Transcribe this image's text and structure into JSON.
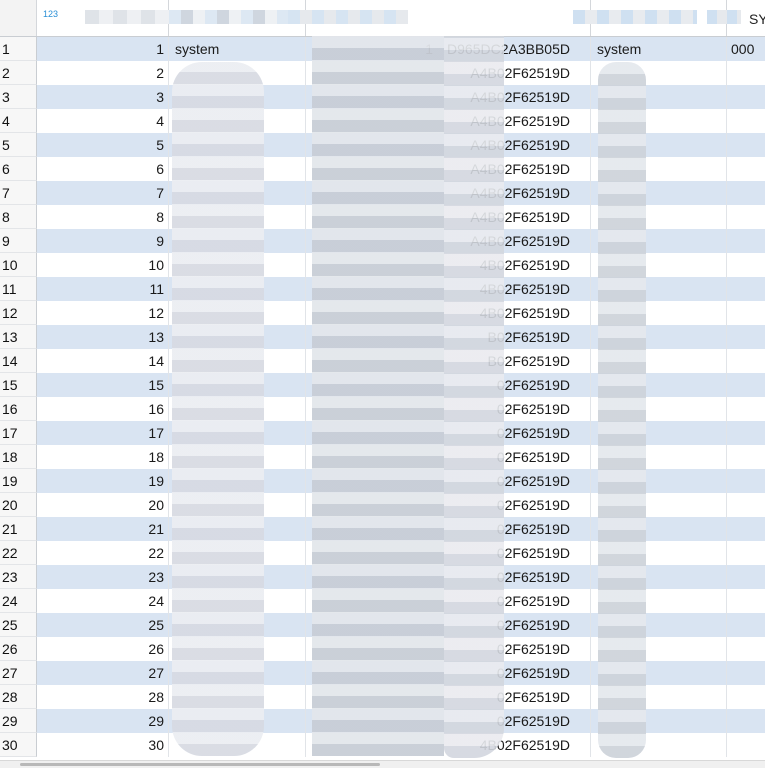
{
  "header": {
    "type_badge": "123",
    "col1_label": "",
    "col2_label": "",
    "col3_label": "",
    "col4_label": "",
    "col5_label": "SY"
  },
  "rows": [
    {
      "row": "1",
      "num": "1",
      "name": "system",
      "id": "1 D965DC2A3BB05D",
      "display": "system",
      "last": "000"
    },
    {
      "row": "2",
      "num": "2",
      "name": "",
      "id": "A4B02F62519D",
      "display": "",
      "last": ""
    },
    {
      "row": "3",
      "num": "3",
      "name": "",
      "id": "A4B02F62519D",
      "display": "",
      "last": ""
    },
    {
      "row": "4",
      "num": "4",
      "name": "",
      "id": "A4B02F62519D",
      "display": "",
      "last": ""
    },
    {
      "row": "5",
      "num": "5",
      "name": "",
      "id": "A4B02F62519D",
      "display": "",
      "last": ""
    },
    {
      "row": "6",
      "num": "6",
      "name": "",
      "id": "A4B02F62519D",
      "display": "",
      "last": ""
    },
    {
      "row": "7",
      "num": "7",
      "name": "",
      "id": "A4B02F62519D",
      "display": "",
      "last": ""
    },
    {
      "row": "8",
      "num": "8",
      "name": "",
      "id": "A4B02F62519D",
      "display": "",
      "last": ""
    },
    {
      "row": "9",
      "num": "9",
      "name": "",
      "id": "A4B02F62519D",
      "display": "",
      "last": ""
    },
    {
      "row": "10",
      "num": "10",
      "name": "",
      "id": "4B02F62519D",
      "display": "",
      "last": ""
    },
    {
      "row": "11",
      "num": "11",
      "name": "",
      "id": "4B02F62519D",
      "display": "",
      "last": ""
    },
    {
      "row": "12",
      "num": "12",
      "name": "",
      "id": "4B02F62519D",
      "display": "",
      "last": ""
    },
    {
      "row": "13",
      "num": "13",
      "name": "",
      "id": "B02F62519D",
      "display": "",
      "last": ""
    },
    {
      "row": "14",
      "num": "14",
      "name": "",
      "id": "B02F62519D",
      "display": "",
      "last": ""
    },
    {
      "row": "15",
      "num": "15",
      "name": "",
      "id": "02F62519D",
      "display": "",
      "last": ""
    },
    {
      "row": "16",
      "num": "16",
      "name": "",
      "id": "02F62519D",
      "display": "",
      "last": ""
    },
    {
      "row": "17",
      "num": "17",
      "name": "",
      "id": "02F62519D",
      "display": "",
      "last": ""
    },
    {
      "row": "18",
      "num": "18",
      "name": "",
      "id": "02F62519D",
      "display": "",
      "last": ""
    },
    {
      "row": "19",
      "num": "19",
      "name": "",
      "id": "02F62519D",
      "display": "",
      "last": ""
    },
    {
      "row": "20",
      "num": "20",
      "name": "",
      "id": "02F62519D",
      "display": "",
      "last": ""
    },
    {
      "row": "21",
      "num": "21",
      "name": "",
      "id": "02F62519D",
      "display": "",
      "last": ""
    },
    {
      "row": "22",
      "num": "22",
      "name": "",
      "id": "02F62519D",
      "display": "",
      "last": ""
    },
    {
      "row": "23",
      "num": "23",
      "name": "",
      "id": "02F62519D",
      "display": "",
      "last": ""
    },
    {
      "row": "24",
      "num": "24",
      "name": "",
      "id": "02F62519D",
      "display": "",
      "last": ""
    },
    {
      "row": "25",
      "num": "25",
      "name": "",
      "id": "02F62519D",
      "display": "",
      "last": ""
    },
    {
      "row": "26",
      "num": "26",
      "name": "",
      "id": "02F62519D",
      "display": "",
      "last": ""
    },
    {
      "row": "27",
      "num": "27",
      "name": "",
      "id": "02F62519D",
      "display": "",
      "last": ""
    },
    {
      "row": "28",
      "num": "28",
      "name": "",
      "id": "02F62519D",
      "display": "",
      "last": ""
    },
    {
      "row": "29",
      "num": "29",
      "name": "",
      "id": "02F62519D",
      "display": "",
      "last": ""
    },
    {
      "row": "30",
      "num": "30",
      "name": "",
      "id": "4B02F62519D",
      "display": "",
      "last": ""
    }
  ]
}
